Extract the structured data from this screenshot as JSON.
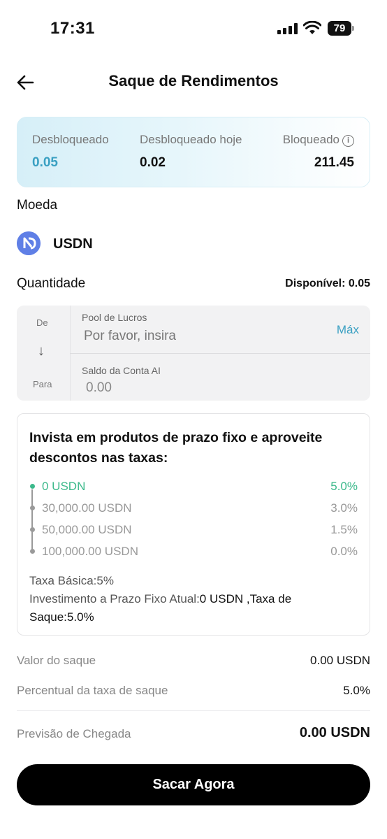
{
  "status_bar": {
    "time": "17:31",
    "battery": "79"
  },
  "header": {
    "title": "Saque de Rendimentos",
    "back_icon": "arrow-left-icon"
  },
  "summary": {
    "unlocked_label": "Desbloqueado",
    "unlocked_value": "0.05",
    "unlocked_today_label": "Desbloqueado hoje",
    "unlocked_today_value": "0.02",
    "locked_label": "Bloqueado",
    "locked_value": "211.45"
  },
  "currency": {
    "label": "Moeda",
    "name": "USDN",
    "icon": "usdn-logo-icon"
  },
  "quantity": {
    "label": "Quantidade",
    "available": "Disponível: 0.05"
  },
  "transfer": {
    "from_side": "De",
    "to_side": "Para",
    "arrow": "↓",
    "from_label": "Pool de Lucros",
    "from_placeholder": "Por favor, insira",
    "max_label": "Máx",
    "to_label": "Saldo da Conta AI",
    "to_value": "0.00"
  },
  "fee_card": {
    "title": "Invista em produtos de prazo fixo e aproveite descontos nas taxas:",
    "tiers": [
      {
        "amount": "0 USDN",
        "rate": "5.0%",
        "active": true
      },
      {
        "amount": "30,000.00 USDN",
        "rate": "3.0%",
        "active": false
      },
      {
        "amount": "50,000.00 USDN",
        "rate": "1.5%",
        "active": false
      },
      {
        "amount": "100,000.00 USDN",
        "rate": "0.0%",
        "active": false
      }
    ],
    "base_fee": "Taxa Básica:5%",
    "current_prefix": "Investimento a Prazo Fixo Atual:",
    "current_amount": "0 USDN",
    "fee_prefix": " ,Taxa de Saque:",
    "fee_value": "5.0%"
  },
  "rows": {
    "amount_label": "Valor do saque",
    "amount_value": "0.00 USDN",
    "pct_label": "Percentual da taxa de saque",
    "pct_value": "5.0%",
    "arrival_label": "Previsão de Chegada",
    "arrival_value": "0.00 USDN"
  },
  "cta": {
    "label": "Sacar Agora"
  },
  "colors": {
    "accent_blue": "#3aa0c2",
    "accent_green": "#3cb98b",
    "coin_blue": "#5f7fe6"
  }
}
